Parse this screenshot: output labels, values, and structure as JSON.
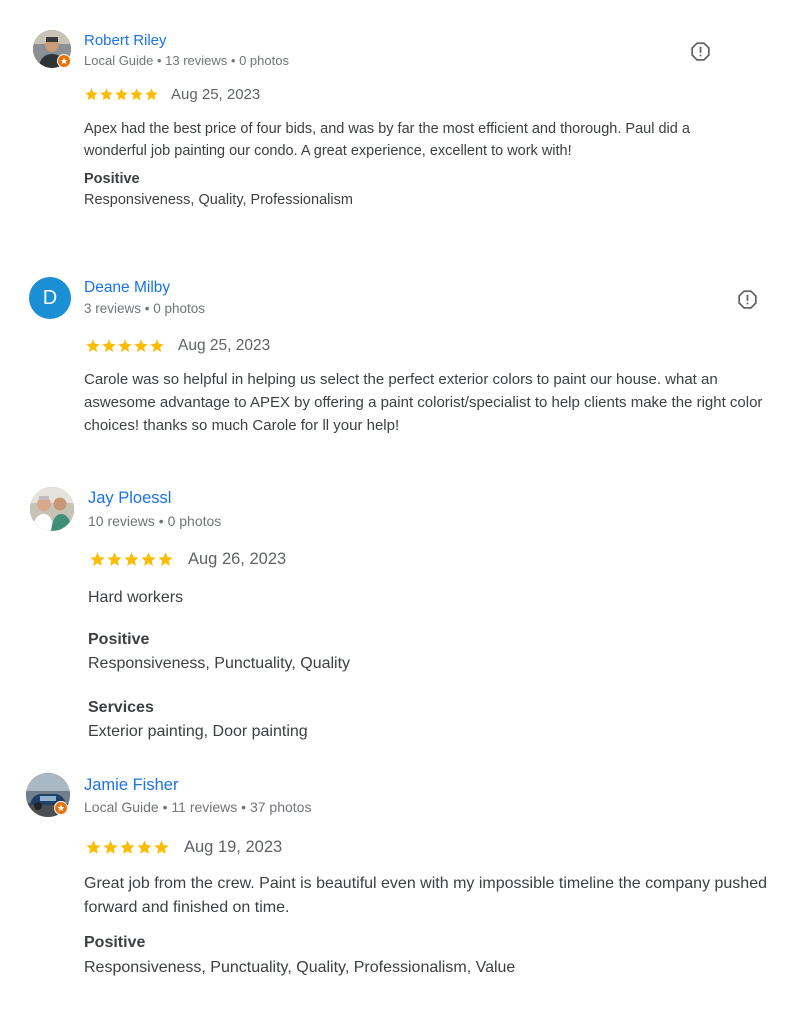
{
  "colors": {
    "name": "#1a73e8",
    "star": "#fbbc04",
    "badge": "#e8710a",
    "letter_avatar": "#1a8fd6"
  },
  "icons": {
    "report": "report-icon",
    "star": "star-icon",
    "guide_badge": "local-guide-badge-icon"
  },
  "reviews": [
    {
      "name": "Robert Riley",
      "meta": "Local Guide • 13 reviews • 0 photos",
      "stars": 5,
      "date": "Aug 25, 2023",
      "text": "Apex had the best price of four bids, and was by far the most efficient and thorough. Paul did a wonderful job painting our condo. A great experience, excellent to work with!",
      "positive_label": "Positive",
      "positive_value": "Responsiveness, Quality, Professionalism"
    },
    {
      "name": "Deane Milby",
      "avatar_letter": "D",
      "meta": "3 reviews • 0 photos",
      "stars": 5,
      "date": "Aug 25, 2023",
      "text": "Carole was so helpful in helping us select the perfect exterior colors to paint our house. what an aswesome advantage to APEX by offering a paint colorist/specialist to help clients make the right color choices! thanks so much Carole for ll your help!"
    },
    {
      "name": "Jay Ploessl",
      "meta": "10 reviews • 0 photos",
      "stars": 5,
      "date": "Aug 26, 2023",
      "text": "Hard workers",
      "positive_label": "Positive",
      "positive_value": "Responsiveness, Punctuality, Quality",
      "services_label": "Services",
      "services_value": "Exterior painting, Door painting"
    },
    {
      "name": "Jamie Fisher",
      "meta": "Local Guide • 11 reviews • 37 photos",
      "stars": 5,
      "date": "Aug 19, 2023",
      "text": "Great job from the crew. Paint is beautiful even with my impossible timeline the company pushed forward and finished on time.",
      "positive_label": "Positive",
      "positive_value": "Responsiveness, Punctuality, Quality, Professionalism, Value"
    }
  ]
}
